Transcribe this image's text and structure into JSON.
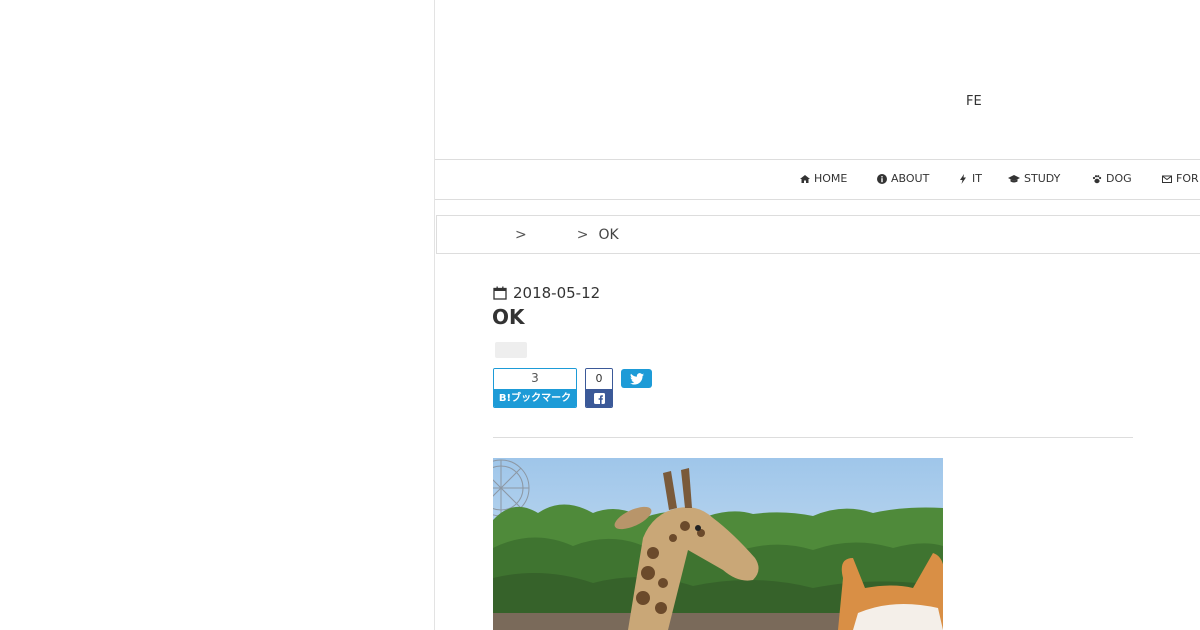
{
  "header": {
    "site_title": "FE"
  },
  "nav": {
    "items": [
      {
        "label": "HOME",
        "icon": "home-icon"
      },
      {
        "label": "ABOUT",
        "icon": "info-icon"
      },
      {
        "label": "IT",
        "icon": "bolt-icon"
      },
      {
        "label": "STUDY",
        "icon": "graduation-cap-icon"
      },
      {
        "label": "DOG",
        "icon": "paw-icon"
      },
      {
        "label": "FOR",
        "icon": "envelope-icon"
      }
    ]
  },
  "breadcrumb": {
    "sep1": ">",
    "sep2": ">",
    "current": "OK"
  },
  "article": {
    "date": "2018-05-12",
    "title": "OK"
  },
  "share": {
    "hatena_count": "3",
    "hatena_label": "B!ブックマーク",
    "facebook_count": "0"
  },
  "colors": {
    "accent": "#1e88c7",
    "hatena": "#1d9bd7",
    "facebook": "#3b5998",
    "twitter": "#1d9bd7"
  }
}
